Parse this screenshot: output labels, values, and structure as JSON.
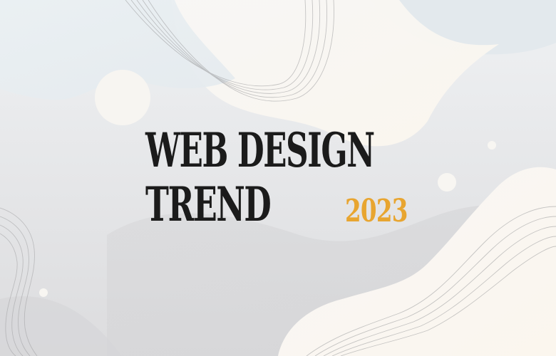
{
  "banner": {
    "title_line1": "WEB DESIGN",
    "title_line2": "TREND",
    "year": "2023"
  },
  "colors": {
    "background": "#e3e3e5",
    "title": "#1b1b1b",
    "accent": "#e8a530"
  }
}
